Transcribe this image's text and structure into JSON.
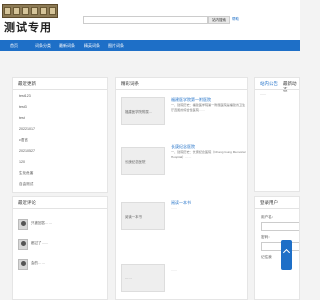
{
  "header": {
    "logo_text": "测试专用",
    "search_placeholder": "",
    "search_button": "站内搜索",
    "help_link": "帮助"
  },
  "nav": [
    {
      "label": "首页"
    },
    {
      "label": "词条分类"
    },
    {
      "label": "最新词条"
    },
    {
      "label": "精英词条"
    },
    {
      "label": "图片词条"
    }
  ],
  "latest_updates": {
    "title": "最近更新",
    "items": [
      "test123",
      "test3",
      "test",
      "20221017",
      "c语言",
      "20210527",
      "120",
      "生化危害",
      "自由测试"
    ]
  },
  "recent_comments": {
    "title": "最近评论",
    "items": [
      "只被回答……",
      "都过了……",
      "会的……"
    ]
  },
  "featured": {
    "title": "精彩词条",
    "items": [
      {
        "title": "福建医学院第一附医院",
        "image_alt": "福建医学院附属…",
        "desc": "一、建院历史：福建医学院第一附属医院是福建省卫生厅直属的综合性医院……"
      },
      {
        "title": "长庚纪念医院",
        "image_alt": "长庚纪念医院",
        "desc": "一、建院历史：长庚纪念医院（Chang Gung Memorial Hospital）……"
      },
      {
        "title": "阅读一本书",
        "image_alt": "阅读一本书",
        "desc": "……"
      },
      {
        "title": "",
        "image_alt": "……",
        "desc": "……"
      }
    ]
  },
  "site_news": {
    "tab_active": "站内公告",
    "tab_other": "最新动态",
    "text": "……"
  },
  "login": {
    "title": "登录用户",
    "username_label": "用户名：",
    "password_label": "密码：",
    "remember_label": "记住我"
  },
  "colors": {
    "nav": "#1e6fc7",
    "link": "#1e6fc7"
  }
}
